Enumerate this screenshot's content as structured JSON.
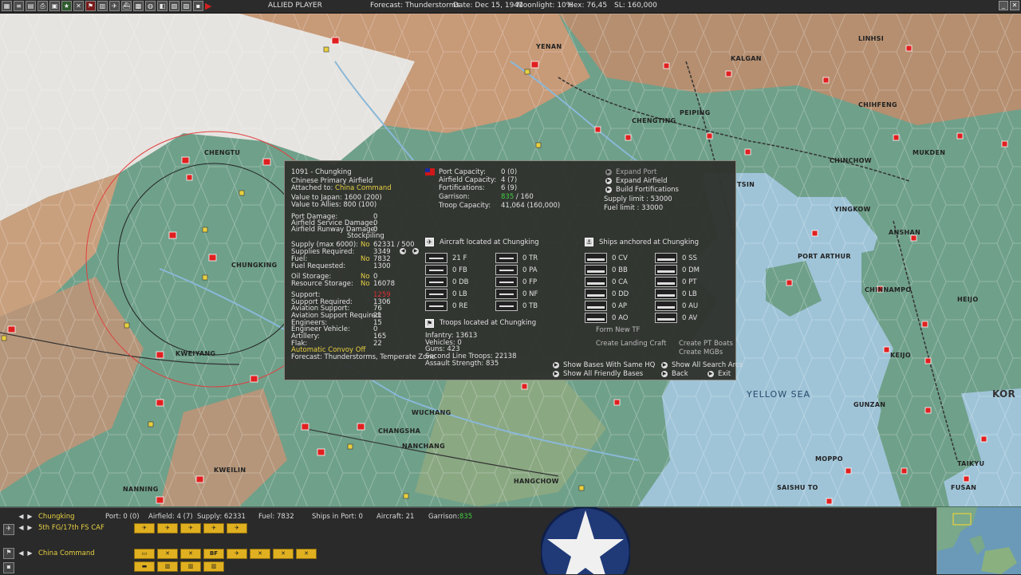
{
  "topbar": {
    "player": "ALLIED PLAYER",
    "forecast": "Forecast: Thunderstorms",
    "date": "Date: Dec 15, 1941",
    "moonlight": "Moonlight: 10%",
    "hex": "Hex: 76,45",
    "sl": "SL: 160,000"
  },
  "map": {
    "labels": [
      "YENAN",
      "LINHSI",
      "KALGAN",
      "CHIHFENG",
      "PEIPING",
      "CHENGTING",
      "CHENGTU",
      "CHUNGKING",
      "KWEIYANG",
      "CHINCHOW",
      "MUKDEN",
      "TSIN",
      "YINGKOW",
      "ANSHAN",
      "PORT ARTHUR",
      "CHINNAMPO",
      "HEIJO",
      "KEIJO",
      "GUNZAN",
      "TAIKYU",
      "FUSAN",
      "MOPPO",
      "SAISHU TO",
      "WUCHANG",
      "CHANGSHA",
      "NANCHANG",
      "KWEILIN",
      "NANNING",
      "HANGCHOW",
      "KOR"
    ],
    "sea_label": "YELLOW SEA",
    "colors": {
      "land": "#6fa08a",
      "mountain": "#c79a78",
      "snow": "#e8e8e8",
      "sea": "#9fc4d8",
      "base_marker": "#e02020"
    }
  },
  "popup": {
    "base_title": "1091 - Chungking",
    "airfield_type": "Chinese Primary Airfield",
    "attached_label": "Attached to:",
    "attached_value": "China Command",
    "value_japan": "Value to Japan:  1600 (200)",
    "value_allies": "Value to Allies:  800 (100)",
    "damage": [
      {
        "label": "Port Damage:",
        "value": "0"
      },
      {
        "label": "Airfield Service Damage:",
        "value": "0"
      },
      {
        "label": "Airfield Runway Damage:",
        "value": "0"
      }
    ],
    "stockpiling": "Stockpiling",
    "supply": [
      {
        "label": "Supply (max 6000):",
        "flag": "No",
        "value": "62331 / 500"
      },
      {
        "label": "Supplies Required:",
        "flag": "",
        "value": "3349"
      },
      {
        "label": "Fuel:",
        "flag": "No",
        "value": "7832"
      },
      {
        "label": "Fuel Requested:",
        "flag": "",
        "value": "1300"
      },
      {
        "label": "Oil Storage:",
        "flag": "No",
        "value": "0"
      },
      {
        "label": "Resource Storage:",
        "flag": "No",
        "value": "16078"
      }
    ],
    "support": [
      {
        "label": "Support:",
        "value": "1259"
      },
      {
        "label": "Support Required:",
        "value": "1306"
      },
      {
        "label": "Aviation Support:",
        "value": "76"
      },
      {
        "label": "Aviation Support Required:",
        "value": "21"
      },
      {
        "label": "Engineers:",
        "value": "15"
      },
      {
        "label": "Engineer Vehicle:",
        "value": "0"
      },
      {
        "label": "Artillery:",
        "value": "165"
      },
      {
        "label": "Flak:",
        "value": "22"
      }
    ],
    "convoy": "Automatic Convoy Off",
    "forecast": "Forecast: Thunderstorms, Temperate Zone",
    "capacity": [
      {
        "label": "Port Capacity:",
        "value": "0 (0)"
      },
      {
        "label": "Airfield Capacity:",
        "value": "4 (7)"
      },
      {
        "label": "Fortifications:",
        "value": "6 (9)"
      },
      {
        "label": "Garrison:",
        "value_green": "835",
        "value": " / 160"
      },
      {
        "label": "Troop Capacity:",
        "value": "41,064  (160,000)"
      }
    ],
    "actions": {
      "expand_port": "Expand Port",
      "expand_airfield": "Expand Airfield",
      "build_fortifications": "Build Fortifications",
      "supply_limit": "Supply limit : 53000",
      "fuel_limit": "Fuel limit : 33000"
    },
    "aircraft_header": "Aircraft located at Chungking",
    "aircraft": [
      {
        "value": "21 F"
      },
      {
        "value": "0 TR"
      },
      {
        "value": "0 FB"
      },
      {
        "value": "0 PA"
      },
      {
        "value": "0 DB"
      },
      {
        "value": "0 FP"
      },
      {
        "value": "0 LB"
      },
      {
        "value": "0 NF"
      },
      {
        "value": "0 RE"
      },
      {
        "value": "0 TB"
      }
    ],
    "ships_header": "Ships anchored at Chungking",
    "ships": [
      {
        "value": "0 CV"
      },
      {
        "value": "0 SS"
      },
      {
        "value": "0 BB"
      },
      {
        "value": "0 DM"
      },
      {
        "value": "0 CA"
      },
      {
        "value": "0 PT"
      },
      {
        "value": "0 DD"
      },
      {
        "value": "0 LB"
      },
      {
        "value": "0 AP"
      },
      {
        "value": "0 AU"
      },
      {
        "value": "0 AO"
      },
      {
        "value": "0 AV"
      }
    ],
    "troops_header": "Troops located at Chungking",
    "troops": [
      "Infantry: 13613",
      "Vehicles: 0",
      "Guns: 423",
      "Second Line Troops: 22138",
      "Assault Strength: 835"
    ],
    "form_tf": "Form New TF",
    "create_landing": "Create Landing Craft",
    "create_pt": "Create PT Boats",
    "create_mgb": "Create MGBs",
    "show_same_hq": "Show Bases With Same HQ",
    "show_search_arcs": "Show All Search Arcs",
    "show_friendly": "Show All Friendly Bases",
    "back": "Back",
    "exit": "Exit"
  },
  "bottombar": {
    "base_name": "Chungking",
    "port": "Port: 0 (0)",
    "airfield": "Airfield: 4 (7)",
    "supply": "Supply: 62331",
    "fuel": "Fuel: 7832",
    "ships_in_port": "Ships in Port: 0",
    "aircraft": "Aircraft: 21",
    "garrison_label": "Garrison:",
    "garrison_value": "835",
    "air_unit": "5th FG/17th FS CAF",
    "hq": "China Command",
    "gold_row3": [
      "BF"
    ]
  }
}
